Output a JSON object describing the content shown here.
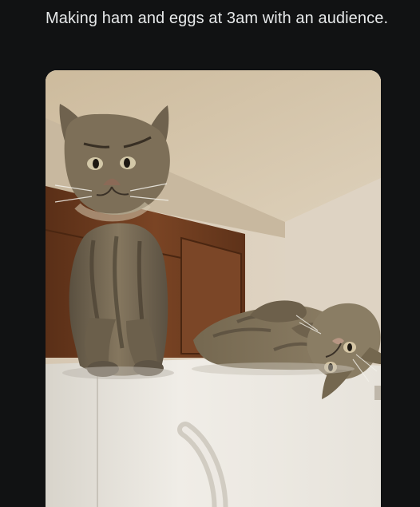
{
  "post": {
    "text": "Making ham and eggs at 3am with an audience."
  },
  "media": {
    "subject": "photo",
    "icon": "photo-icon"
  },
  "colors": {
    "background": "#111213",
    "text": "#e7e9ea",
    "ceiling": "#d7c7ad",
    "wall": "#d9ccb8",
    "cabinet": "#6b3b1d",
    "fridge": "#ece9e2",
    "tabby_dark": "#4d4436",
    "tabby_mid": "#7b6d57",
    "tabby_light": "#b4a58b"
  }
}
